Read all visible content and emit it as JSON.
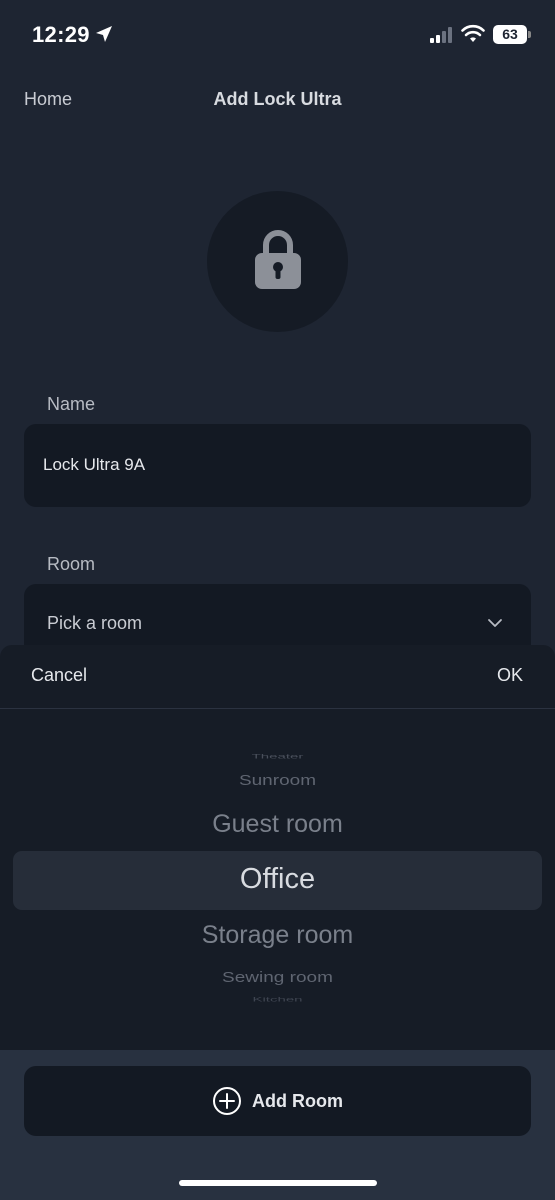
{
  "status_bar": {
    "time": "12:29",
    "battery": "63"
  },
  "nav": {
    "back_label": "Home",
    "title": "Add Lock Ultra"
  },
  "form": {
    "name_label": "Name",
    "name_value": "Lock Ultra 9A",
    "room_label": "Room",
    "room_placeholder": "Pick a room"
  },
  "sheet": {
    "cancel_label": "Cancel",
    "ok_label": "OK",
    "picker_items": [
      "Theater",
      "Sunroom",
      "Guest room",
      "Office",
      "Storage room",
      "Sewing room",
      "Kitchen"
    ],
    "selected": "Office"
  },
  "footer": {
    "add_room_label": "Add Room"
  },
  "colors": {
    "background": "#1e2532",
    "field": "#131923",
    "sheet": "#161c26",
    "highlight": "#262d39"
  }
}
